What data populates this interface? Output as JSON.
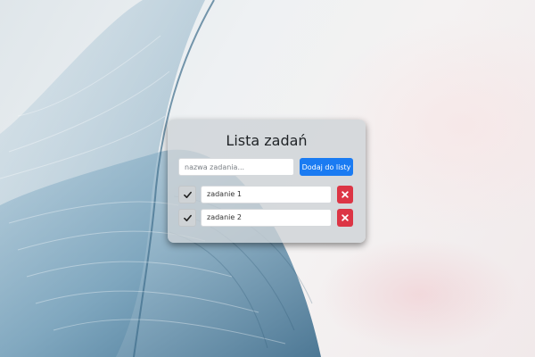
{
  "app": {
    "title": "Lista zadań"
  },
  "new_task": {
    "placeholder": "nazwa zadania...",
    "value": "",
    "add_label": "Dodaj do listy"
  },
  "tasks": [
    {
      "label": "zadanie 1",
      "complete_icon": "check-icon",
      "delete_icon": "close-icon"
    },
    {
      "label": "zadanie 2",
      "complete_icon": "check-icon",
      "delete_icon": "close-icon"
    }
  ],
  "colors": {
    "add_button": "#1a7bf2",
    "delete_button": "#dc3545",
    "card_background": "#cdd2d6"
  }
}
